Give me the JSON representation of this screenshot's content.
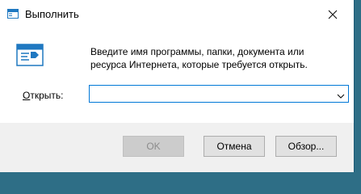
{
  "window": {
    "title": "Выполнить",
    "close_icon": "close-icon",
    "title_icon": "run-dialog-icon"
  },
  "main": {
    "icon": "run-program-icon",
    "description": "Введите имя программы, папки, документа или ресурса Интернета, которые требуется открыть.",
    "open_label_prefix": "",
    "open_label_access": "О",
    "open_label_rest": "ткрыть:",
    "open_value": "",
    "dropdown_icon": "chevron-down-icon"
  },
  "buttons": {
    "ok": "OK",
    "cancel": "Отмена",
    "browse": "Обзор..."
  },
  "colors": {
    "accent": "#0078d7",
    "footer_bg": "#f0f0f0",
    "desktop": "#2e6e86"
  }
}
